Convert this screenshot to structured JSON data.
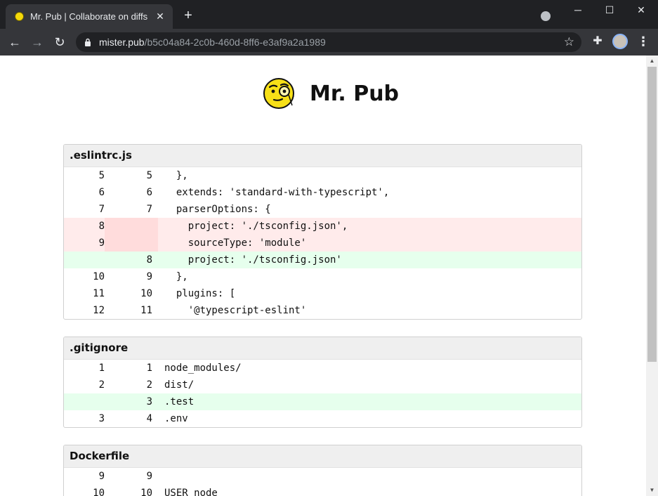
{
  "browser": {
    "tab_title": "Mr. Pub | Collaborate on diffs",
    "url_host": "mister.pub",
    "url_path": "/b5c04a84-2c0b-460d-8ff6-e3af9a2a1989"
  },
  "site": {
    "title": "Mr. Pub"
  },
  "files": [
    {
      "name": ".eslintrc.js",
      "lines": [
        {
          "old": "5",
          "new": "5",
          "type": "ctx",
          "code": "  },"
        },
        {
          "old": "6",
          "new": "6",
          "type": "ctx",
          "code": "  extends: 'standard-with-typescript',"
        },
        {
          "old": "7",
          "new": "7",
          "type": "ctx",
          "code": "  parserOptions: {"
        },
        {
          "old": "8",
          "new": "",
          "type": "del",
          "code": "    project: './tsconfig.json',"
        },
        {
          "old": "9",
          "new": "",
          "type": "del",
          "code": "    sourceType: 'module'"
        },
        {
          "old": "",
          "new": "8",
          "type": "add",
          "code": "    project: './tsconfig.json'"
        },
        {
          "old": "10",
          "new": "9",
          "type": "ctx",
          "code": "  },"
        },
        {
          "old": "11",
          "new": "10",
          "type": "ctx",
          "code": "  plugins: ["
        },
        {
          "old": "12",
          "new": "11",
          "type": "ctx",
          "code": "    '@typescript-eslint'"
        }
      ]
    },
    {
      "name": ".gitignore",
      "lines": [
        {
          "old": "1",
          "new": "1",
          "type": "ctx",
          "code": "node_modules/"
        },
        {
          "old": "2",
          "new": "2",
          "type": "ctx",
          "code": "dist/"
        },
        {
          "old": "",
          "new": "3",
          "type": "add",
          "code": ".test"
        },
        {
          "old": "3",
          "new": "4",
          "type": "ctx",
          "code": ".env"
        }
      ]
    },
    {
      "name": "Dockerfile",
      "lines": [
        {
          "old": "9",
          "new": "9",
          "type": "ctx",
          "code": ""
        },
        {
          "old": "10",
          "new": "10",
          "type": "ctx",
          "code": "USER node"
        }
      ]
    }
  ]
}
